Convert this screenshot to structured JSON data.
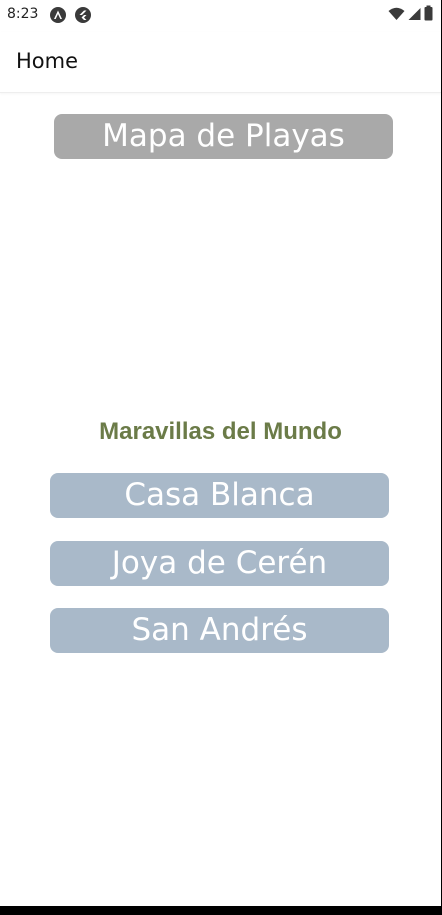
{
  "status_bar": {
    "time": "8:23",
    "notification_icons": [
      "app-notification-icon",
      "flutter-notification-icon"
    ],
    "system_icons": [
      "wifi-icon",
      "cell-signal-icon",
      "battery-icon"
    ]
  },
  "header": {
    "title": "Home"
  },
  "main": {
    "map_button_label": "Mapa de Playas",
    "section_title": "Maravillas del Mundo",
    "places": [
      {
        "label": "Casa Blanca"
      },
      {
        "label": "Joya de Cerén"
      },
      {
        "label": "San Andrés"
      }
    ]
  },
  "colors": {
    "map_button": "#a9a9a9",
    "place_button": "#a9b9c9",
    "section_title": "#6b7b48",
    "button_text": "#ffffff"
  }
}
